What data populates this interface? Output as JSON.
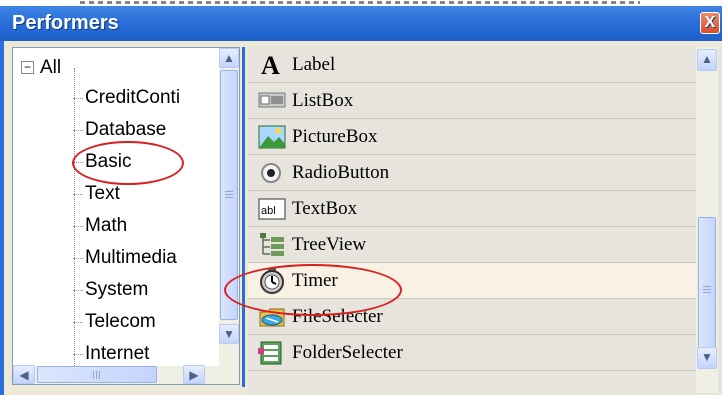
{
  "window": {
    "title": "Performers",
    "close_label": "X"
  },
  "tree": {
    "root_label": "All",
    "root_expander": "−",
    "items": [
      {
        "label": "CreditConti"
      },
      {
        "label": "Database"
      },
      {
        "label": "Basic"
      },
      {
        "label": "Text"
      },
      {
        "label": "Math"
      },
      {
        "label": "Multimedia"
      },
      {
        "label": "System"
      },
      {
        "label": "Telecom"
      },
      {
        "label": "Internet"
      }
    ],
    "highlighted": "Basic"
  },
  "components": {
    "items": [
      {
        "label": "Label",
        "icon": "letter-a-icon"
      },
      {
        "label": "ListBox",
        "icon": "listbox-icon"
      },
      {
        "label": "PictureBox",
        "icon": "picture-icon"
      },
      {
        "label": "RadioButton",
        "icon": "radio-button-icon"
      },
      {
        "label": "TextBox",
        "icon": "textbox-icon"
      },
      {
        "label": "TreeView",
        "icon": "treeview-icon"
      },
      {
        "label": "Timer",
        "icon": "stopwatch-icon"
      },
      {
        "label": "FileSelecter",
        "icon": "file-selecter-icon"
      },
      {
        "label": "FolderSelecter",
        "icon": "folder-selecter-icon"
      }
    ],
    "selected": "Timer",
    "textbox_icon_text": "abl"
  },
  "scroll": {
    "up_arrow": "▲",
    "down_arrow": "▼",
    "left_arrow": "◀",
    "right_arrow": "▶"
  },
  "colors": {
    "titlebar": "#2a6fd8",
    "annotation": "#d82020",
    "selected_row": "#f8f1e4"
  }
}
